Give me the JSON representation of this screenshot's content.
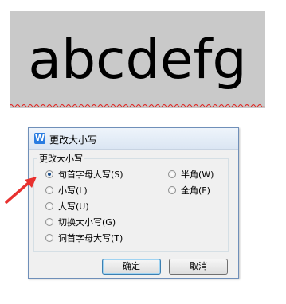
{
  "document": {
    "sample_text": "abcdefg"
  },
  "dialog": {
    "title": "更改大小写",
    "group_label": "更改大小写",
    "options_left": [
      {
        "label": "句首字母大写(S)",
        "checked": true
      },
      {
        "label": "小写(L)",
        "checked": false
      },
      {
        "label": "大写(U)",
        "checked": false
      },
      {
        "label": "切换大小写(G)",
        "checked": false
      },
      {
        "label": "词首字母大写(T)",
        "checked": false
      }
    ],
    "options_right": [
      {
        "label": "半角(W)",
        "checked": false
      },
      {
        "label": "全角(F)",
        "checked": false
      }
    ],
    "ok_label": "确定",
    "cancel_label": "取消"
  },
  "colors": {
    "arrow": "#e8312f",
    "doc_highlight": "#c9c9c9",
    "squiggle": "#e0201c"
  }
}
